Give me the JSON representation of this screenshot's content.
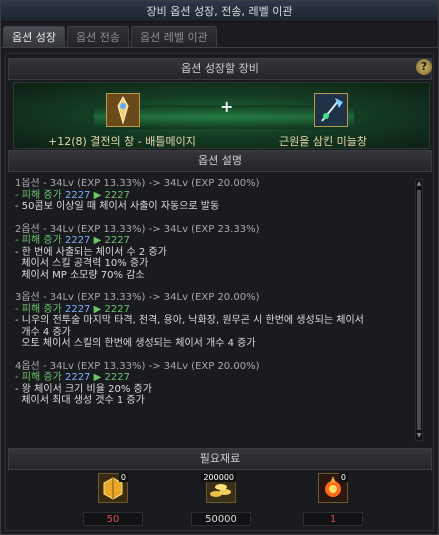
{
  "window": {
    "title": "장비 옵션 성장, 전송, 레벨 이관"
  },
  "tabs": [
    {
      "label": "옵션 성장",
      "active": true
    },
    {
      "label": "옵션 전송",
      "active": false
    },
    {
      "label": "옵션 레벨 이관",
      "active": false
    }
  ],
  "growth_section": {
    "header": "옵션 성장할 장비",
    "help": "?",
    "plus": "+",
    "left_item": {
      "name": "+12(8) 결전의 창 - 배틀메이지",
      "icon": "spear-icon"
    },
    "right_item": {
      "name": "근원을 삼킨 미늘창",
      "icon": "halberd-icon"
    }
  },
  "description": {
    "header": "옵션 설명",
    "options": [
      {
        "title": "1옵션 - 34Lv (EXP 13.33%) -> 34Lv (EXP 20.00%)",
        "damage_prefix": "- 피해 증가",
        "damage_from": "2227",
        "damage_arrow": "▶",
        "damage_to": "2227",
        "effects": [
          "- 50콤보 이상일 때 체이서 사출이 자동으로 발동"
        ]
      },
      {
        "title": "2옵션 - 34Lv (EXP 13.33%) -> 34Lv (EXP 23.33%)",
        "damage_prefix": "- 피해 증가",
        "damage_from": "2227",
        "damage_arrow": "▶",
        "damage_to": "2227",
        "effects": [
          "- 한 번에 사출되는 체이서 수 2 증가",
          "  체이서 스킬 공격력 10% 증가",
          "  체이서 MP 소모량 70% 감소"
        ]
      },
      {
        "title": "3옵션 - 34Lv (EXP 13.33%) -> 34Lv (EXP 20.00%)",
        "damage_prefix": "- 피해 증가",
        "damage_from": "2227",
        "damage_arrow": "▶",
        "damage_to": "2227",
        "effects": [
          "- 니우의 전투술 마지막 타격, 천격, 용아, 낙화장, 원무곤 시 한번에 생성되는 체이서",
          "  개수 4 증가",
          "  오토 체이서 스킬의 한번에 생성되는 체이서 개수 4 증가"
        ]
      },
      {
        "title": "4옵션 - 34Lv (EXP 13.33%) -> 34Lv (EXP 20.00%)",
        "damage_prefix": "- 피해 증가",
        "damage_from": "2227",
        "damage_arrow": "▶",
        "damage_to": "2227",
        "effects": [
          "- 왕 체이서 크기 비율 20% 증가",
          "  체이서 최대 생성 갯수 1 증가"
        ]
      }
    ]
  },
  "materials": {
    "header": "필요재료",
    "items": [
      {
        "icon": "gold-box-icon",
        "owned": "0",
        "required": "50",
        "insufficient": true
      },
      {
        "icon": "gold-coins-icon",
        "owned": "200000",
        "required": "50000",
        "insufficient": false
      },
      {
        "icon": "fire-orb-icon",
        "owned": "0",
        "required": "1",
        "insufficient": true
      }
    ]
  }
}
